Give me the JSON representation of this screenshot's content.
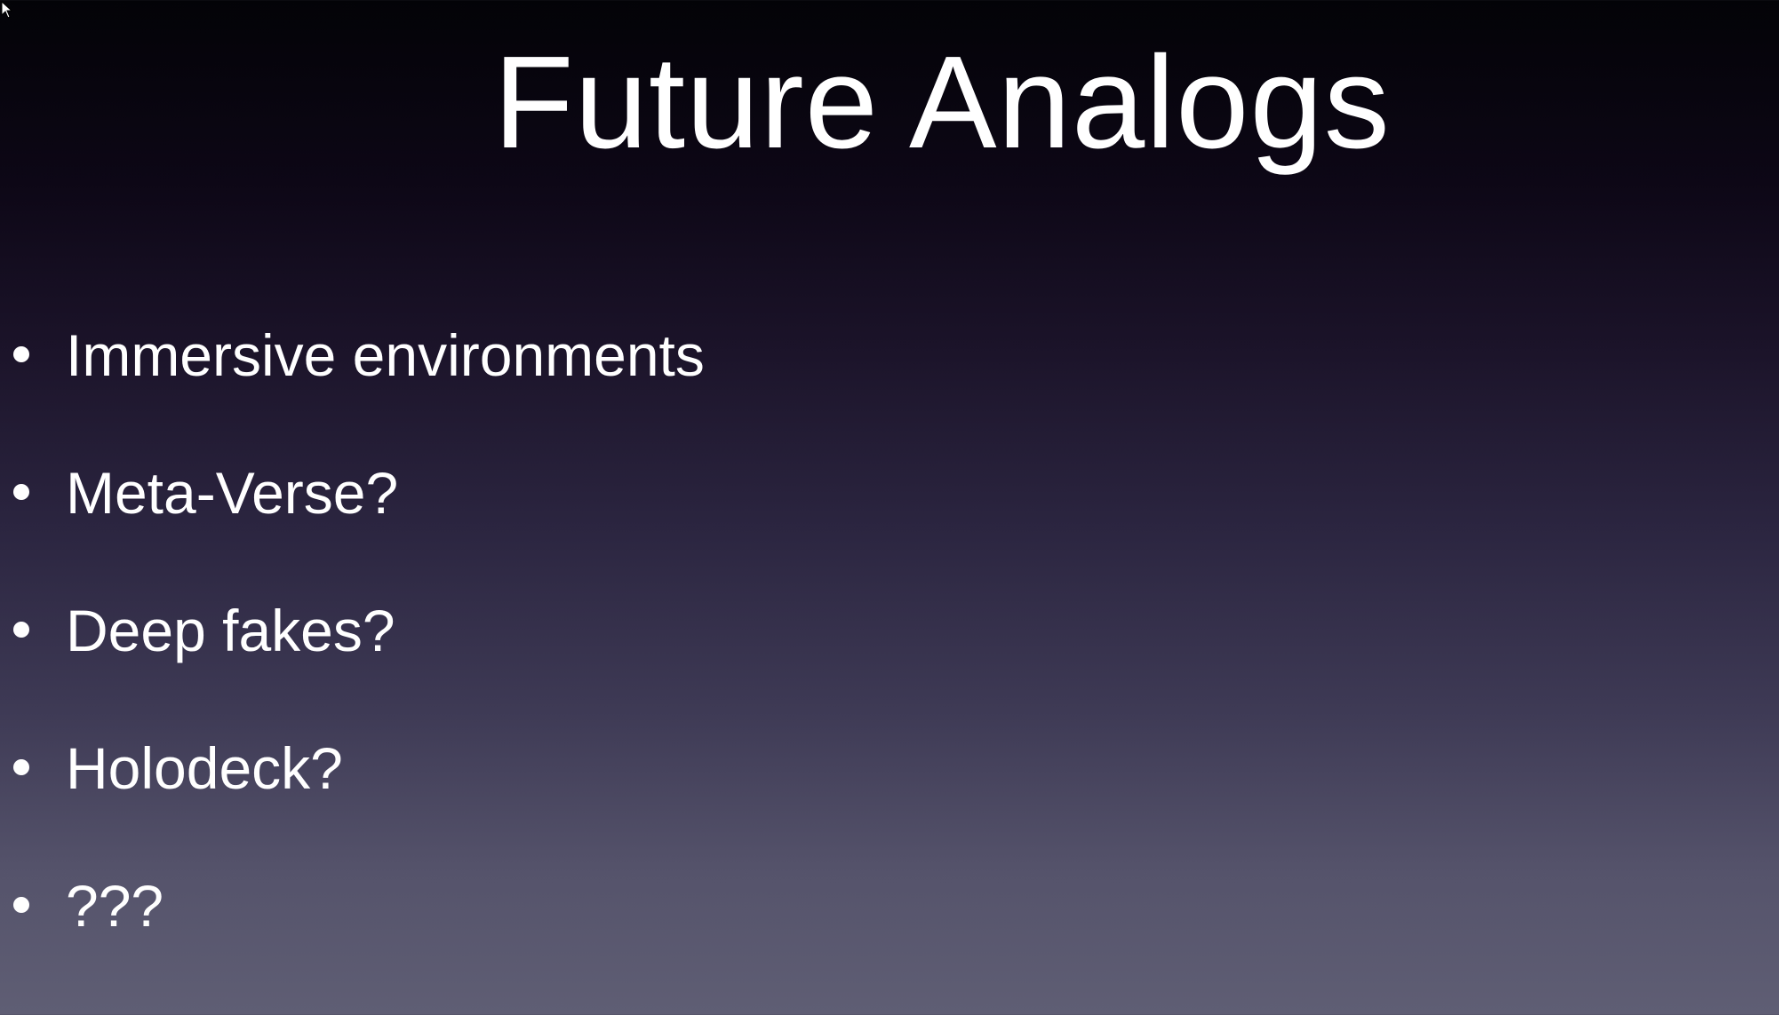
{
  "slide": {
    "title": "Future Analogs",
    "bullets": [
      "Immersive environments",
      "Meta-Verse?",
      "Deep fakes?",
      "Holodeck?",
      "???"
    ]
  },
  "colors": {
    "text": "#ffffff",
    "background_top": "#030307",
    "background_bottom": "#5f5e74"
  },
  "icons": {
    "cursor": "mouse-pointer-icon",
    "bullet": "bullet-dot-icon"
  }
}
